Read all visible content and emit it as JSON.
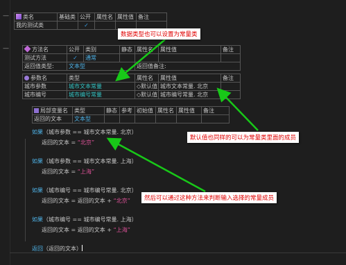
{
  "class_table": {
    "headers": [
      "类名",
      "基础类",
      "公开",
      "属性名",
      "属性值",
      "备注"
    ],
    "row": [
      "我的测试类",
      "",
      "✓",
      "",
      "",
      ""
    ]
  },
  "method_table": {
    "headers": [
      "方法名",
      "公开",
      "类别",
      "静态",
      "属性名",
      "属性值",
      "备注"
    ],
    "row": [
      "测试方法",
      "✓",
      "通常",
      "",
      "",
      "",
      ""
    ],
    "return_label": "返回值类型:",
    "return_type": "文本型",
    "return_note": "返回值备注:"
  },
  "param_table": {
    "headers": [
      "参数名",
      "类型",
      "属性名",
      "属性值",
      "备注"
    ],
    "rows": [
      [
        "城市参数",
        "城市文本常量",
        "◇默认值",
        "城市文本常量. 北京",
        ""
      ],
      [
        "城市编号",
        "城市编号常量",
        "◇默认值",
        "城市编号常量. 北京",
        ""
      ]
    ]
  },
  "local_table": {
    "headers": [
      "局部变量名",
      "类型",
      "静态",
      "参考",
      "初始值",
      "属性名",
      "属性值",
      "备注"
    ],
    "row": [
      "返回的文本",
      "文本型",
      "",
      "",
      "",
      "",
      "",
      ""
    ]
  },
  "code": {
    "if_kw": "如果",
    "ret_kw": "返回",
    "lines": [
      {
        "cond": "（城市参数 == 城市文本常量. 北京）",
        "ret_prefix": "返回的文本 = ",
        "str": "“北京”"
      },
      {
        "cond": "（城市参数 == 城市文本常量. 上海）",
        "ret_prefix": "返回的文本 = ",
        "str": "“上海”"
      },
      {
        "cond": "（城市编号 == 城市编号常量. 北京）",
        "ret_prefix": "返回的文本 = 返回的文本 + ",
        "str": "“北京”"
      },
      {
        "cond": "（城市编号 == 城市编号常量. 上海）",
        "ret_prefix": "返回的文本 = 返回的文本 + ",
        "str": "“上海”"
      }
    ],
    "return_expr": "（返回的文本）"
  },
  "annotations": {
    "note1": "数据类型也可以设置为常量类",
    "note2": "默认值也同样的可以为常量类里面的成员",
    "note3": "然后可以通过这种方法来判断输入选择的常量成员"
  },
  "colors": {
    "background": "#1e1e1e",
    "keyword": "#4fb3e8",
    "string": "#e0529a",
    "annotation_text": "#e00000",
    "arrow": "#18c818"
  }
}
